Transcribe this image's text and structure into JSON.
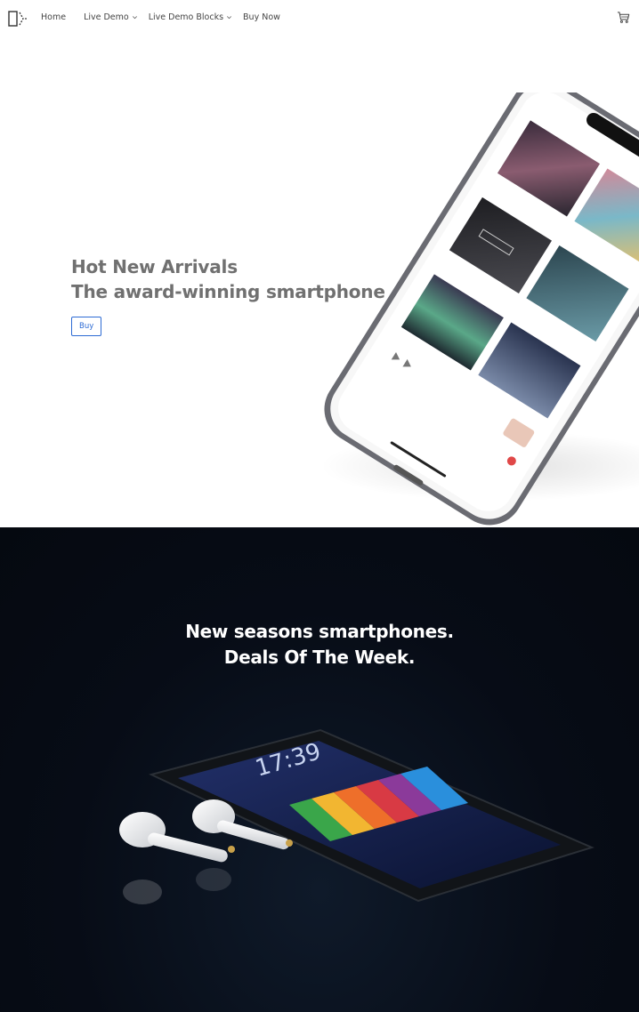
{
  "header": {
    "logo": "device-logo-icon",
    "nav": [
      {
        "label": "Home",
        "has_caret": false
      },
      {
        "label": "Live Demo",
        "has_caret": true
      },
      {
        "label": "Live Demo Blocks",
        "has_caret": true
      },
      {
        "label": "Buy Now",
        "has_caret": false
      }
    ],
    "cart_icon": "cart-icon"
  },
  "hero": {
    "title_line1": "Hot New Arrivals",
    "title_line2": "The award-winning smartphone",
    "button_label": "Buy",
    "accent_color": "#2d6bd4",
    "image": "smartphone-product-photo"
  },
  "deals": {
    "title_line1": "New seasons smartphones.",
    "title_line2": "Deals Of The Week.",
    "image": "smartphone-and-earbuds-photo",
    "phone_time": "17:39"
  }
}
